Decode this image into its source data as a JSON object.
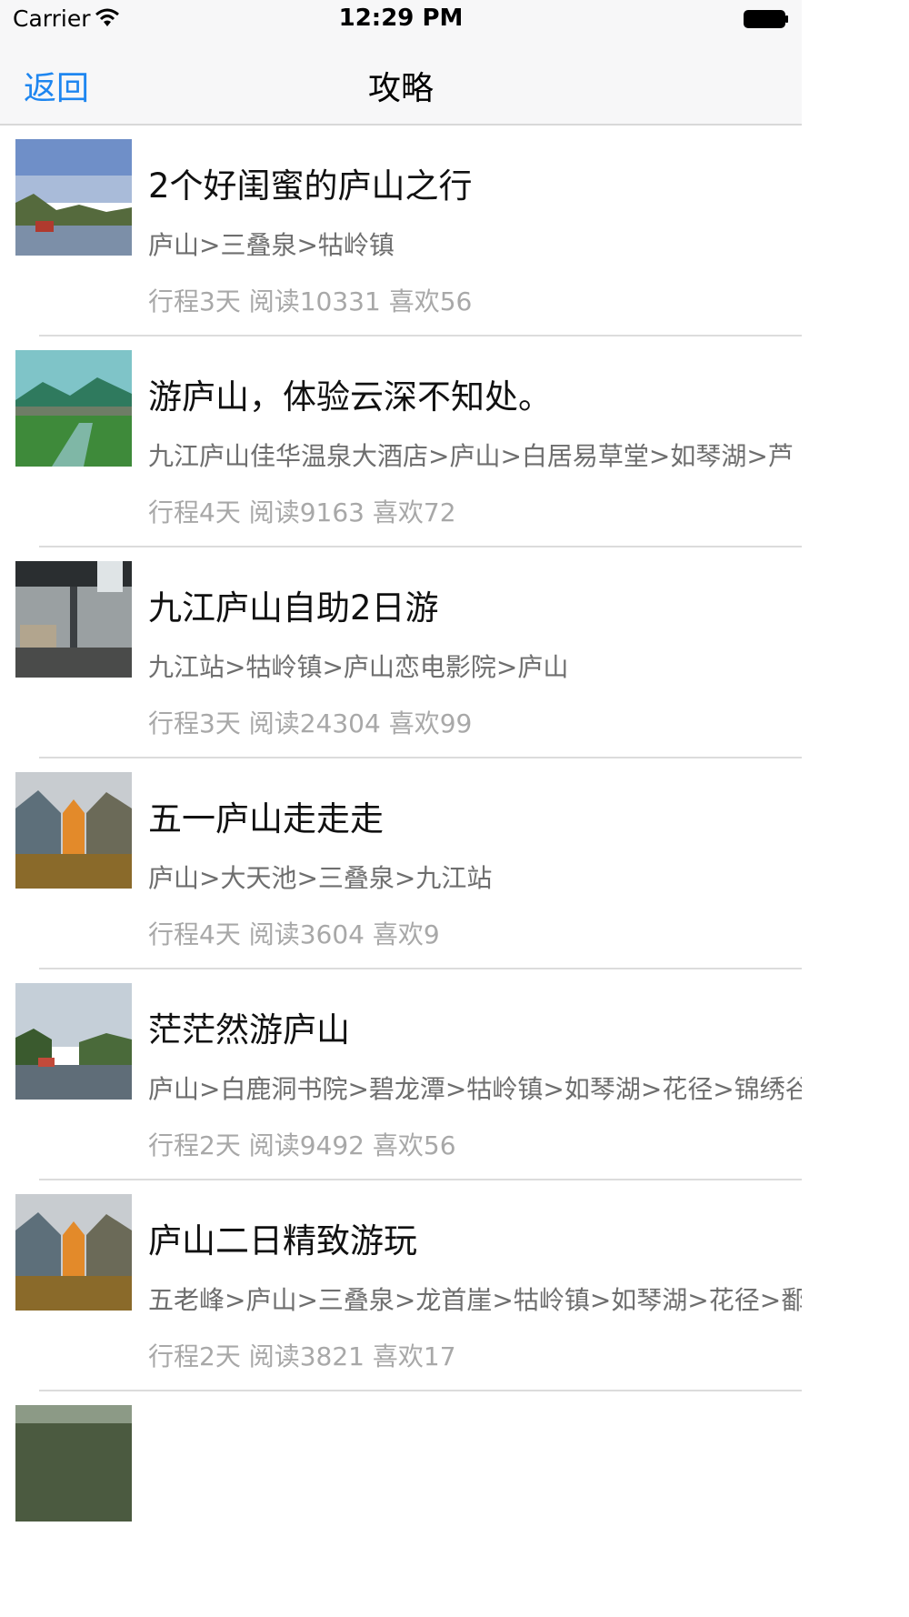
{
  "status_bar": {
    "carrier": "Carrier",
    "time": "12:29 PM"
  },
  "nav": {
    "back_label": "返回",
    "title": "攻略"
  },
  "items": [
    {
      "title": "2个好闺蜜的庐山之行",
      "route": "庐山>三叠泉>牯岭镇",
      "stats": "行程3天 阅读10331 喜欢56"
    },
    {
      "title": "游庐山，体验云深不知处。",
      "route": "九江庐山佳华温泉大酒店>庐山>白居易草堂>如琴湖>芦",
      "stats": "行程4天 阅读9163 喜欢72"
    },
    {
      "title": "九江庐山自助2日游",
      "route": "九江站>牯岭镇>庐山恋电影院>庐山",
      "stats": "行程3天 阅读24304 喜欢99"
    },
    {
      "title": "五一庐山走走走",
      "route": "庐山>大天池>三叠泉>九江站",
      "stats": "行程4天 阅读3604 喜欢9"
    },
    {
      "title": "茫茫然游庐山",
      "route": "庐山>白鹿洞书院>碧龙潭>牯岭镇>如琴湖>花径>锦绣谷",
      "stats": "行程2天 阅读9492 喜欢56"
    },
    {
      "title": "庐山二日精致游玩",
      "route": "五老峰>庐山>三叠泉>龙首崖>牯岭镇>如琴湖>花径>鄱",
      "stats": "行程2天 阅读3821 喜欢17"
    }
  ]
}
